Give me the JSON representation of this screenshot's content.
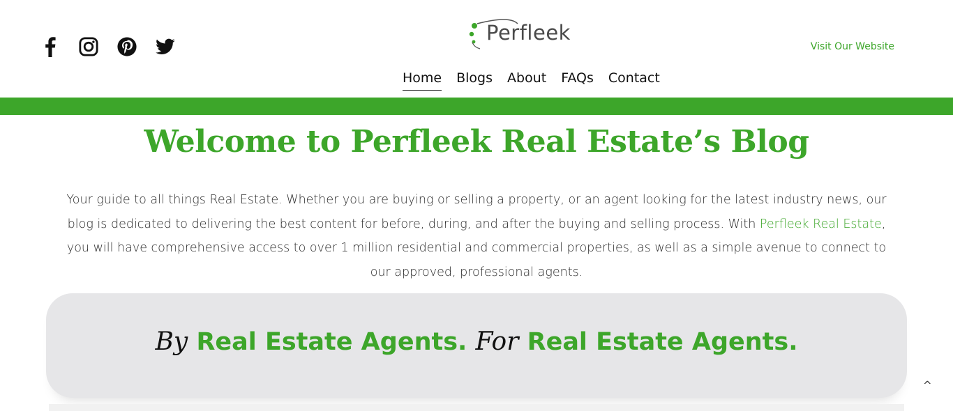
{
  "header": {
    "social": [
      {
        "icon": "facebook-icon"
      },
      {
        "icon": "instagram-icon"
      },
      {
        "icon": "pinterest-icon"
      },
      {
        "icon": "twitter-icon"
      }
    ],
    "logo_text": "Perfleek",
    "visit_link": "Visit Our Website",
    "nav": [
      "Home",
      "Blogs",
      "About",
      "FAQs",
      "Contact"
    ],
    "active_nav": "Home"
  },
  "colors": {
    "accent": "#3da62a",
    "card_bg": "#e6e6e8"
  },
  "main": {
    "title": "Welcome to Perfleek Real Estate’s Blog",
    "intro_before_link": "Your guide to all things Real Estate. Whether you are buying or selling a property, or an agent looking for the latest industry news, our blog is dedicated to delivering the best content for before, during, and after the buying and selling process. With ",
    "intro_link": "Perfleek Real Estate",
    "intro_after_link": ", you will have comprehensive access to over 1 million residential and commercial properties, as well as a simple avenue to connect to our approved, professional agents.",
    "tagline": {
      "by": "By",
      "part1": "Real Estate Agents.",
      "for": "For",
      "part2": "Real Estate Agents."
    },
    "back_to_top": "^"
  }
}
